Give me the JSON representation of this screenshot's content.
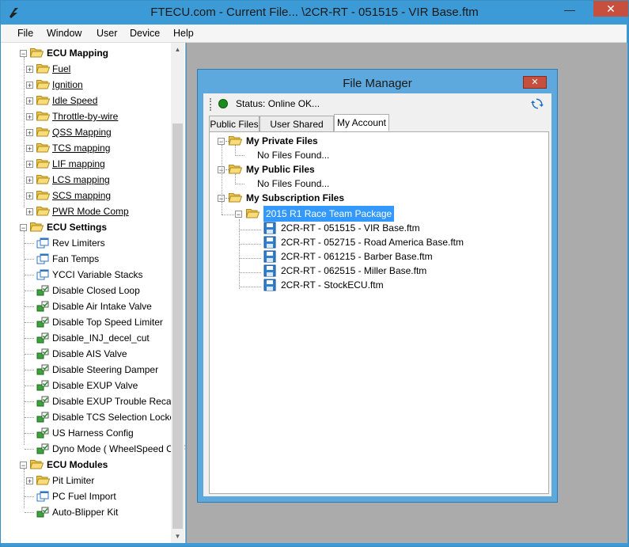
{
  "window": {
    "title": "FTECU.com - Current File... \\2CR-RT - 051515 - VIR Base.ftm",
    "minimize_glyph": "—",
    "maximize_glyph": "☐",
    "close_glyph": "✕"
  },
  "menu": [
    "File",
    "Window",
    "User",
    "Device",
    "Help"
  ],
  "tree": {
    "mapping": {
      "label": "ECU Mapping",
      "items": [
        "Fuel",
        "Ignition",
        "Idle Speed",
        "Throttle-by-wire",
        "QSS Mapping",
        "TCS mapping",
        "LIF mapping",
        "LCS mapping",
        "SCS mapping",
        "PWR Mode Comp"
      ]
    },
    "settings": {
      "label": "ECU Settings",
      "items": [
        "Rev Limiters",
        "Fan Temps",
        "YCCI Variable Stacks",
        "Disable Closed Loop",
        "Disable Air Intake Valve",
        "Disable Top Speed Limiter",
        "Disable_INJ_decel_cut",
        "Disable AIS Valve",
        "Disable Steering Damper",
        "Disable EXUP Valve",
        "Disable EXUP Trouble Recall",
        "Disable TCS Selection Lockout",
        "US Harness Config",
        "Dyno Mode ( WheelSpeed OFF"
      ]
    },
    "modules": {
      "label": "ECU Modules",
      "items": [
        "Pit Limiter",
        "PC Fuel Import",
        "Auto-Blipper Kit"
      ]
    }
  },
  "dialog": {
    "title": "File Manager",
    "close_glyph": "✕",
    "status": "Status: Online OK...",
    "tabs": [
      "Public Files",
      "User Shared Files",
      "My Account"
    ],
    "active_tab": "My Account",
    "sections": {
      "private": {
        "label": "My Private Files",
        "empty": "No Files Found..."
      },
      "public": {
        "label": "My Public Files",
        "empty": "No Files Found..."
      },
      "subscription": {
        "label": "My Subscription Files",
        "package": "2015 R1 Race Team Package",
        "files": [
          "2CR-RT - 051515 - VIR Base.ftm",
          "2CR-RT - 052715 - Road America Base.ftm",
          "2CR-RT - 061215 - Barber Base.ftm",
          "2CR-RT - 062515 - Miller Base.ftm",
          "2CR-RT - StockECU.ftm"
        ]
      }
    }
  },
  "icons": {
    "app": "ftecu-logo-icon",
    "folder": "folder-open-icon",
    "setting": "window-setting-icon",
    "toggle": "toggle-setting-icon",
    "file": "disk-file-icon",
    "refresh": "refresh-icon"
  },
  "colors": {
    "titlebar": "#3c9bd6",
    "close": "#c74f3e",
    "status_online": "#1d8a1d",
    "selection": "#3399ff"
  }
}
